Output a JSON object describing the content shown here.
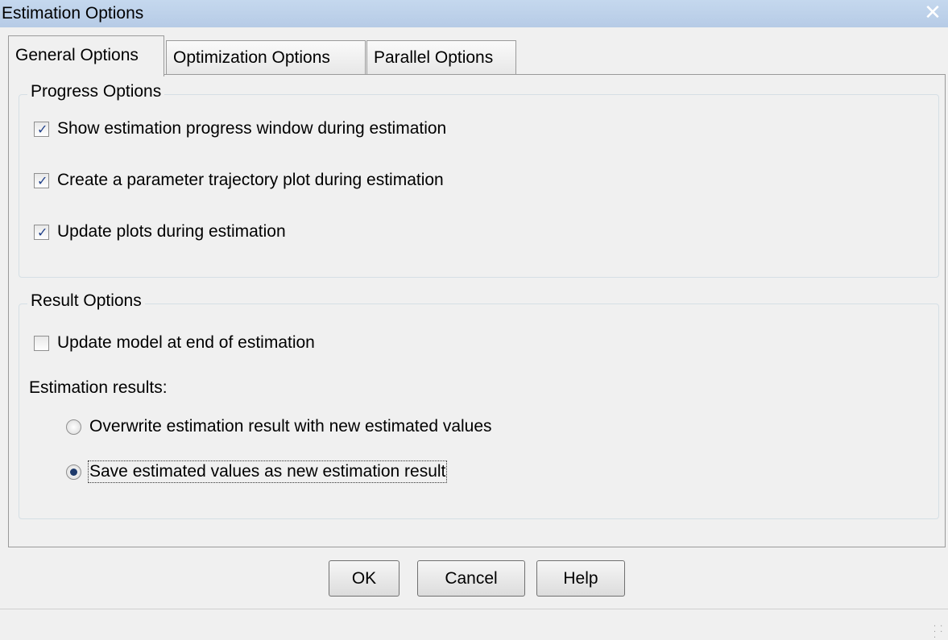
{
  "window": {
    "title": "Estimation Options",
    "close_icon": "close-icon"
  },
  "tabs": [
    {
      "label": "General Options",
      "active": true
    },
    {
      "label": "Optimization Options",
      "active": false
    },
    {
      "label": "Parallel Options",
      "active": false
    }
  ],
  "progress_options": {
    "title": "Progress Options",
    "items": [
      {
        "label": "Show estimation progress window during estimation",
        "checked": true
      },
      {
        "label": "Create a parameter trajectory plot during estimation",
        "checked": true
      },
      {
        "label": "Update plots during estimation",
        "checked": true
      }
    ]
  },
  "result_options": {
    "title": "Result Options",
    "update_model": {
      "label": "Update model at end of estimation",
      "checked": false
    },
    "results_label": "Estimation results:",
    "radios": [
      {
        "label": "Overwrite estimation result with new estimated values",
        "selected": false
      },
      {
        "label": "Save estimated values as new estimation result",
        "selected": true
      }
    ]
  },
  "buttons": {
    "ok": "OK",
    "cancel": "Cancel",
    "help": "Help"
  }
}
